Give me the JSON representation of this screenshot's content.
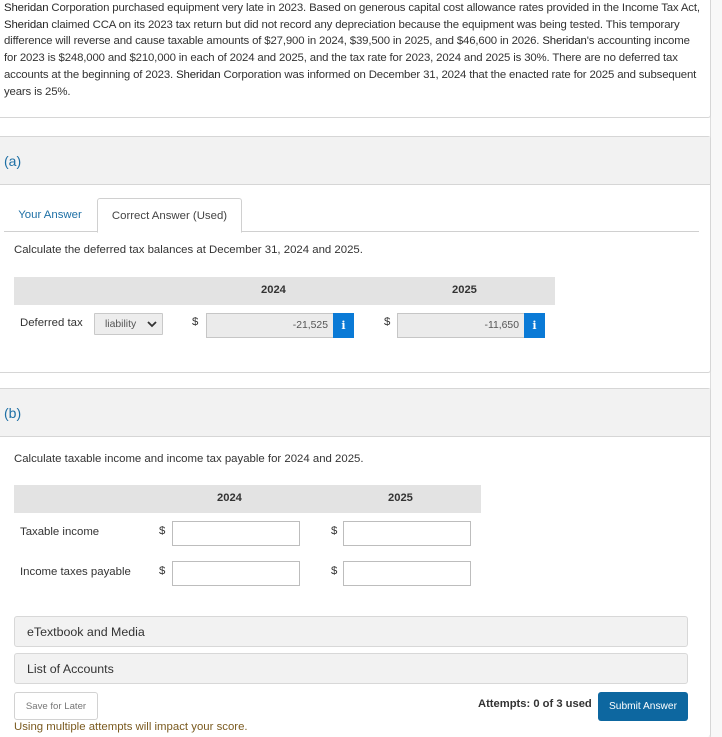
{
  "problem": {
    "company": "Sheridan",
    "text_segments": [
      {
        "bold": true,
        "text": "Sheridan"
      },
      {
        "bold": false,
        "text": " Corporation purchased equipment very late in 2023. Based on generous capital cost allowance rates provided in the Income Tax Act, "
      },
      {
        "bold": true,
        "text": "Sheridan"
      },
      {
        "bold": false,
        "text": " claimed CCA on its 2023 tax return but did not record any depreciation because the equipment was being tested. This temporary difference will reverse and cause taxable amounts of $27,900 in 2024, $39,500 in 2025, and $46,600 in 2026. "
      },
      {
        "bold": true,
        "text": "Sheridan"
      },
      {
        "bold": false,
        "text": "'s accounting income for 2023 is $248,000 and $210,000 in each of 2024 and 2025, and the tax rate for 2023, 2024 and 2025 is 30%. There are no deferred tax accounts at the beginning of 2023. "
      },
      {
        "bold": true,
        "text": "Sheridan"
      },
      {
        "bold": false,
        "text": " Corporation was informed on December 31, 2024 that the enacted rate for 2025 and subsequent years is 25%."
      }
    ]
  },
  "part_a": {
    "label": "(a)",
    "tabs": [
      {
        "label": "Your Answer",
        "active": false
      },
      {
        "label": "Correct Answer (Used)",
        "active": true
      }
    ],
    "instruction": "Calculate the deferred tax balances at December 31, 2024 and 2025.",
    "columns": [
      "2024",
      "2025"
    ],
    "row": {
      "label": "Deferred tax",
      "select_value": "liability",
      "currency": "$",
      "values": [
        "-21,525",
        "-11,650"
      ],
      "info_icon": "i"
    }
  },
  "part_b": {
    "label": "(b)",
    "instruction": "Calculate taxable income and income tax payable for 2024 and 2025.",
    "columns": [
      "2024",
      "2025"
    ],
    "rows": [
      {
        "label": "Taxable income",
        "currency": "$",
        "values": [
          "",
          ""
        ]
      },
      {
        "label": "Income taxes payable",
        "currency": "$",
        "values": [
          "",
          ""
        ]
      }
    ]
  },
  "resources": {
    "etextbook": "eTextbook and Media",
    "accounts": "List of Accounts"
  },
  "footer": {
    "save_label": "Save for Later",
    "attempts": "Attempts: 0 of 3 used",
    "submit_label": "Submit Answer",
    "warning": "Using multiple attempts will impact your score."
  },
  "colors": {
    "link_blue": "#1d6fa5",
    "info_blue": "#0a7ad6",
    "submit_blue": "#0d67a0",
    "warning_brown": "#7a5a1f"
  }
}
